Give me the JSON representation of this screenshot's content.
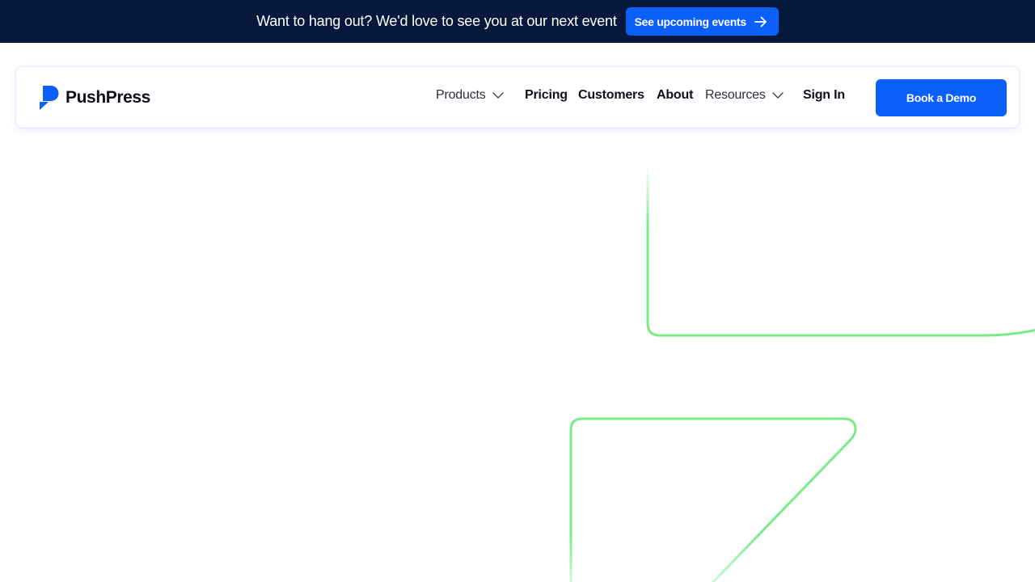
{
  "announcement": {
    "text": "Want to hang out? We'd love to see you at our next event",
    "button_label": "See upcoming events"
  },
  "brand": {
    "name": "PushPress",
    "logo_icon": "pushpress-p-logo-icon"
  },
  "nav": {
    "items": [
      {
        "label": "Products",
        "has_dropdown": true
      },
      {
        "label": "Pricing",
        "has_dropdown": false
      },
      {
        "label": "Customers",
        "has_dropdown": false
      },
      {
        "label": "About",
        "has_dropdown": false
      },
      {
        "label": "Resources",
        "has_dropdown": true
      },
      {
        "label": "Sign In",
        "has_dropdown": false
      }
    ],
    "cta_label": "Book a Demo"
  },
  "colors": {
    "announcement_bg": "#06193d",
    "accent_blue": "#0b5ffb",
    "decor_green": "#79ec86"
  }
}
